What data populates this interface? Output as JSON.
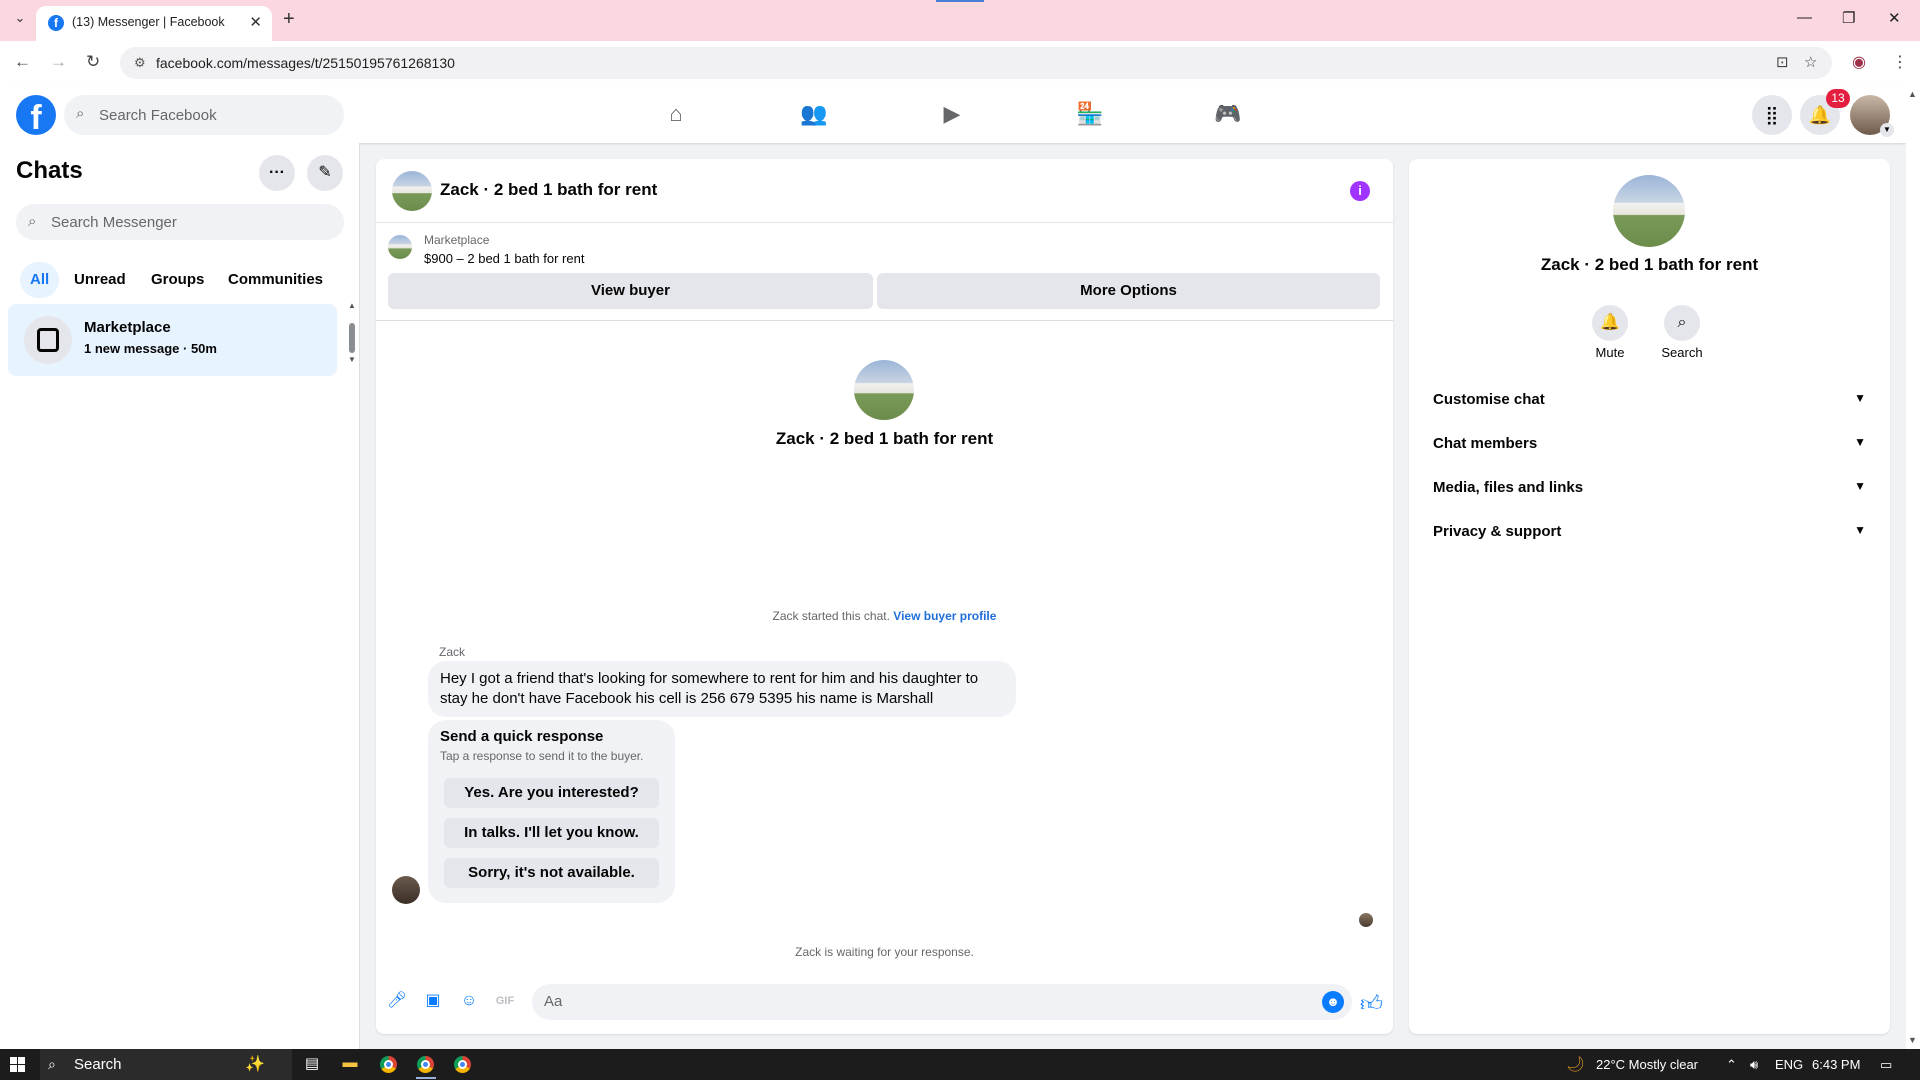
{
  "browser": {
    "tab_title": "(13) Messenger | Facebook",
    "url": "facebook.com/messages/t/25150195761268130",
    "tab_favicon_letter": "f"
  },
  "fb": {
    "search_placeholder": "Search Facebook",
    "notifications_count": "13",
    "nav_icons": [
      "home-icon",
      "friends-icon",
      "video-icon",
      "marketplace-icon",
      "gaming-icon"
    ]
  },
  "chats": {
    "title": "Chats",
    "search_placeholder": "Search Messenger",
    "filters": [
      "All",
      "Unread",
      "Groups",
      "Communities"
    ],
    "active_filter": "All",
    "items": [
      {
        "name": "Marketplace",
        "preview": "1 new message · 50m"
      }
    ]
  },
  "conversation": {
    "title": "Zack · 2 bed 1 bath for rent",
    "marketplace_label": "Marketplace",
    "listing": "$900 – 2 bed 1 bath for rent",
    "view_buyer": "View buyer",
    "more_options": "More Options",
    "intro_name": "Zack · 2 bed 1 bath for rent",
    "started_text": "Zack started this chat.",
    "started_link": "View buyer profile",
    "sender": "Zack",
    "message": "Hey I got a friend that's looking  for somewhere to rent for him and his daughter to stay he don't have Facebook his cell is 256 679 5395 his name is Marshall",
    "quick_title": "Send a quick response",
    "quick_sub": "Tap a response to send it to the buyer.",
    "quick_responses": [
      "Yes. Are you interested?",
      "In talks. I'll let you know.",
      "Sorry, it's not available."
    ],
    "waiting": "Zack is waiting for your response.",
    "composer_placeholder": "Aa"
  },
  "info_panel": {
    "name": "Zack · 2 bed 1 bath for rent",
    "mute": "Mute",
    "search": "Search",
    "sections": [
      "Customise chat",
      "Chat members",
      "Media, files and links",
      "Privacy & support"
    ]
  },
  "taskbar": {
    "search": "Search",
    "weather": "22°C  Mostly clear",
    "lang": "ENG",
    "time": "6:43 PM"
  },
  "colors": {
    "accent": "#1877f2",
    "messenger_blue": "#0a7cff",
    "info_purple": "#a033ff",
    "tabstrip": "#fbd7e0",
    "badge_red": "#e41e3f"
  }
}
